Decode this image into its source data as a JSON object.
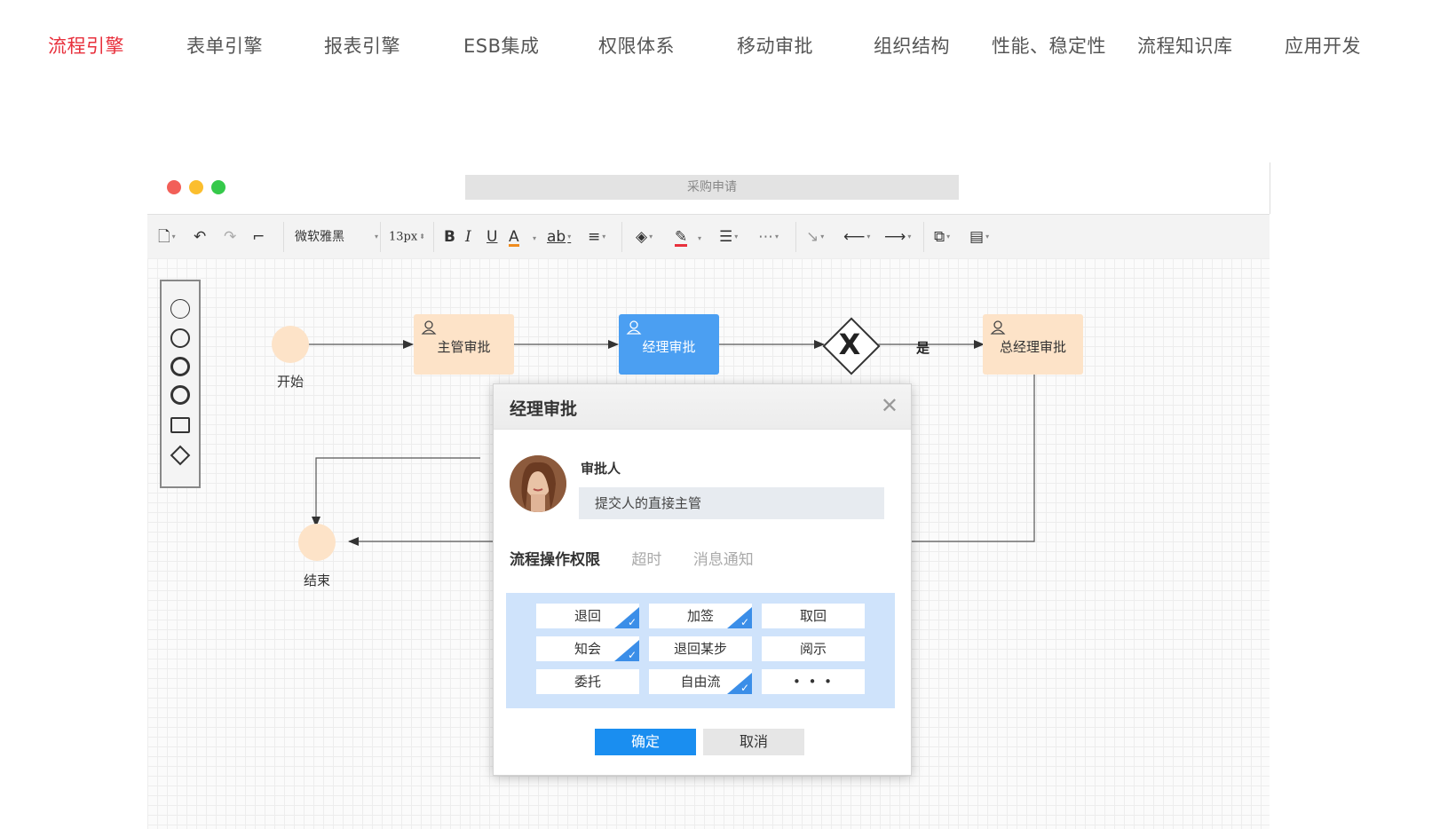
{
  "nav": {
    "items": [
      {
        "label": "流程引擎",
        "active": true
      },
      {
        "label": "表单引擎"
      },
      {
        "label": "报表引擎"
      },
      {
        "label": "ESB集成"
      },
      {
        "label": "权限体系"
      },
      {
        "label": "移动审批"
      },
      {
        "label": "组织结构"
      },
      {
        "label": "性能、稳定性"
      },
      {
        "label": "流程知识库"
      },
      {
        "label": "应用开发"
      }
    ],
    "active_color": "#e8303c"
  },
  "window": {
    "title": "采购申请"
  },
  "toolbar": {
    "font_family_value": "微软雅黑",
    "font_size_value": "13px",
    "bold_label": "B",
    "italic_label": "I",
    "underline_label": "U",
    "font_color_label": "A",
    "highlight_label": "ab"
  },
  "flow": {
    "start_label": "开始",
    "end_label": "结束",
    "tasks": [
      {
        "label": "主管审批"
      },
      {
        "label": "经理审批",
        "selected": true
      },
      {
        "label": "总经理审批"
      }
    ],
    "gateway_symbol": "X",
    "yes_label": "是",
    "selected_color": "#4b9ff2",
    "node_color": "#fde3c8"
  },
  "dialog": {
    "title": "经理审批",
    "approver_label": "审批人",
    "approver_value": "提交人的直接主管",
    "tabs": [
      {
        "label": "流程操作权限",
        "active": true
      },
      {
        "label": "超时"
      },
      {
        "label": "消息通知"
      }
    ],
    "permissions": [
      {
        "label": "退回",
        "checked": true
      },
      {
        "label": "加签",
        "checked": true
      },
      {
        "label": "取回",
        "checked": false
      },
      {
        "label": "知会",
        "checked": true
      },
      {
        "label": "退回某步",
        "checked": false
      },
      {
        "label": "阅示",
        "checked": false
      },
      {
        "label": "委托",
        "checked": false
      },
      {
        "label": "自由流",
        "checked": true
      },
      {
        "label": "• • •",
        "checked": false
      }
    ],
    "ok_label": "确定",
    "cancel_label": "取消",
    "ok_color": "#1a8ef0",
    "panel_color": "#cfe3fb"
  }
}
